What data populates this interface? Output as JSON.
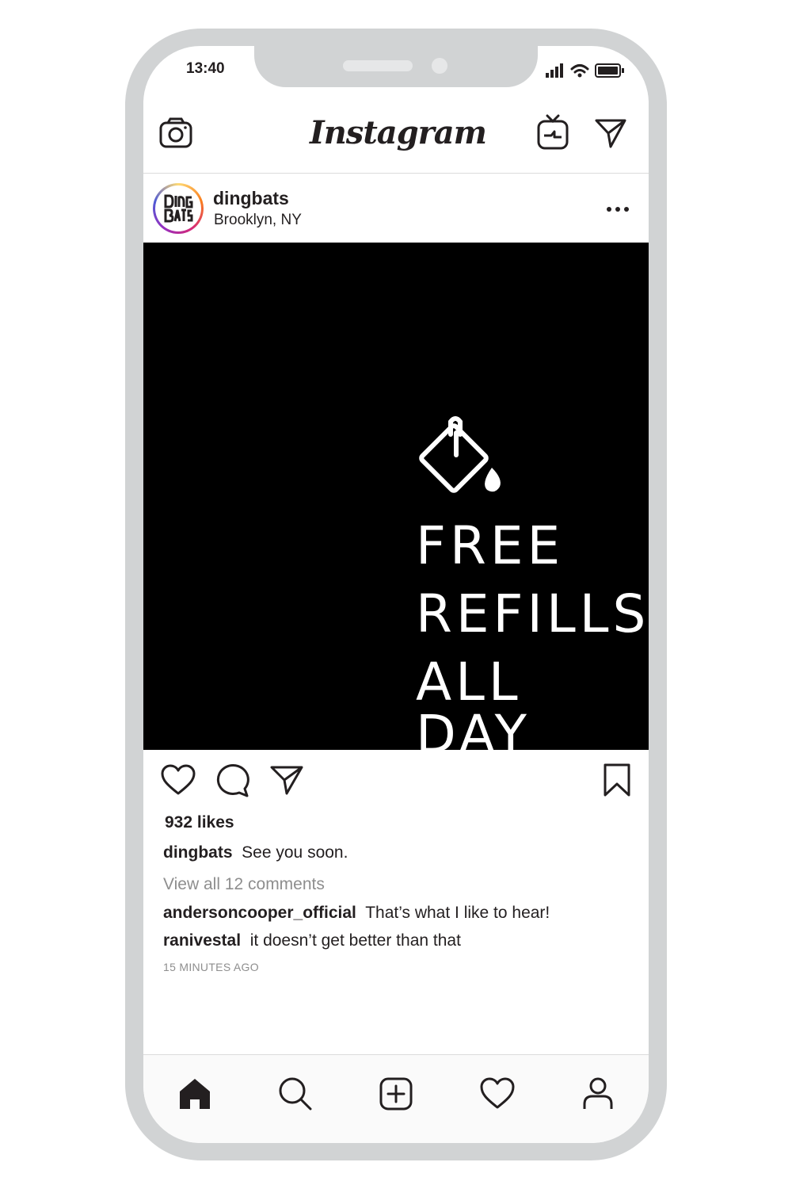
{
  "status_bar": {
    "time": "13:40"
  },
  "app": {
    "logo": "Instagram"
  },
  "icons": {
    "camera": "camera-icon",
    "igtv": "igtv-icon",
    "direct": "paper-plane-icon",
    "more": "more-dots-icon",
    "like": "heart-icon",
    "comment": "comment-icon",
    "share": "paper-plane-icon",
    "save": "bookmark-icon",
    "home": "home-icon",
    "search": "search-icon",
    "add": "plus-square-icon",
    "activity": "heart-icon",
    "profile": "person-icon",
    "paint_bucket": "paint-bucket-icon"
  },
  "post": {
    "username": "dingbats",
    "location": "Brooklyn, NY",
    "image_text": [
      "FREE",
      "REFILLS",
      "ALL DAY"
    ],
    "likes": "932 likes",
    "caption": {
      "user": "dingbats",
      "text": "See you soon."
    },
    "view_all_comments": "View all 12 comments",
    "comments": [
      {
        "user": "andersoncooper_official",
        "text": "That’s what I like to hear!"
      },
      {
        "user": "ranivestal",
        "text": "it doesn’t get better than that"
      }
    ],
    "timestamp": "15 MINUTES AGO"
  },
  "colors": {
    "frame": "#d1d3d4",
    "ink": "#231f20",
    "muted": "#8e8e8e",
    "image_bg": "#000000"
  }
}
